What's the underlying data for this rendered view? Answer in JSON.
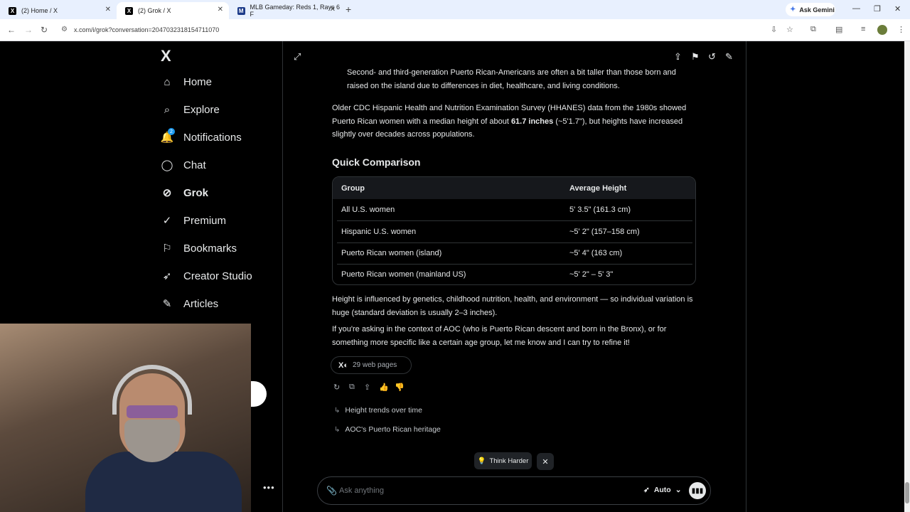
{
  "browser": {
    "tabs": [
      {
        "title": "(2) Home / X",
        "favicon": "X"
      },
      {
        "title": "(2) Grok / X",
        "favicon": "X"
      },
      {
        "title": "MLB Gameday: Reds 1, Rays 6 F",
        "favicon": "M"
      }
    ],
    "new_tab": "+",
    "ask_gemini": "Ask Gemini",
    "url": "x.com/i/grok?conversation=2047032318154711070"
  },
  "sidebar": {
    "logo": "X",
    "items": [
      {
        "label": "Home",
        "icon": "home-icon"
      },
      {
        "label": "Explore",
        "icon": "search-icon"
      },
      {
        "label": "Notifications",
        "icon": "bell-icon",
        "badge": "2"
      },
      {
        "label": "Chat",
        "icon": "chat-icon"
      },
      {
        "label": "Grok",
        "icon": "grok-icon"
      },
      {
        "label": "Premium",
        "icon": "premium-icon"
      },
      {
        "label": "Bookmarks",
        "icon": "bookmark-icon"
      },
      {
        "label": "Creator Studio",
        "icon": "rocket-icon"
      },
      {
        "label": "Articles",
        "icon": "article-icon"
      }
    ]
  },
  "response": {
    "bullet_text": "Second- and third-generation Puerto Rican-Americans are often a bit taller than those born and raised on the island due to differences in diet, healthcare, and living conditions.",
    "para1_before": "Older CDC Hispanic Health and Nutrition Examination Survey (HHANES) data from the 1980s showed Puerto Rican women with a median height of about ",
    "para1_bold": "61.7 inches",
    "para1_after": " (~5'1.7\"), but heights have increased slightly over decades across populations.",
    "heading": "Quick Comparison",
    "table": {
      "headers": [
        "Group",
        "Average Height"
      ],
      "rows": [
        [
          "All U.S. women",
          "5' 3.5\" (161.3 cm)"
        ],
        [
          "Hispanic U.S. women",
          "~5' 2\" (157–158 cm)"
        ],
        [
          "Puerto Rican women (island)",
          "~5' 4\" (163 cm)"
        ],
        [
          "Puerto Rican women (mainland US)",
          "~5' 2\" – 5' 3\""
        ]
      ]
    },
    "para2": "Height is influenced by genetics, childhood nutrition, health, and environment — so individual variation is huge (standard deviation is usually 2–3 inches).",
    "para3": "If you're asking in the context of AOC (who is Puerto Rican descent and born in the Bronx), or for something more specific like a certain age group, let me know and I can try to refine it!",
    "sources": "29 web pages",
    "suggestions": [
      "Height trends over time",
      "AOC's Puerto Rican heritage"
    ]
  },
  "composer": {
    "think_harder": "Think Harder",
    "placeholder": "Ask anything",
    "mode": "Auto"
  }
}
